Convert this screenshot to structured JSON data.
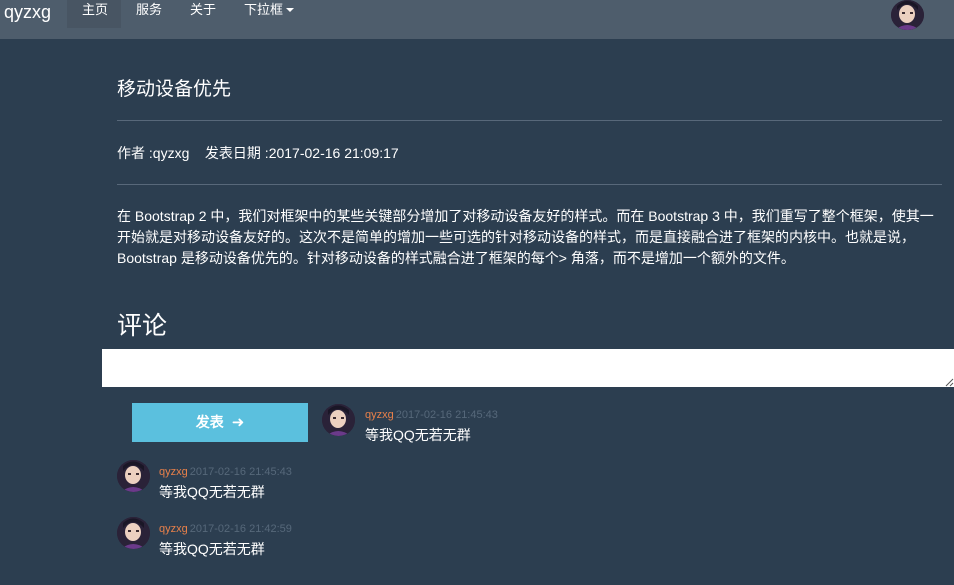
{
  "navbar": {
    "brand": "qyzxg",
    "items": [
      {
        "label": "主页",
        "active": true
      },
      {
        "label": "服务",
        "active": false
      },
      {
        "label": "关于",
        "active": false
      },
      {
        "label": "下拉框",
        "active": false,
        "dropdown": true
      }
    ],
    "avatar_icon": "user-avatar"
  },
  "article": {
    "title": "移动设备优先",
    "meta": "作者 :qyzxg    发表日期 :2017-02-16 21:09:17",
    "body": "在 Bootstrap 2 中，我们对框架中的某些关键部分增加了对移动设备友好的样式。而在 Bootstrap 3 中，我们重写了整个框架，使其一开始就是对移动设备友好的。这次不是简单的增加一些可选的针对移动设备的样式，而是直接融合进了框架的内核中。也就是说，Bootstrap 是移动设备优先的。针对移动设备的样式融合进了框架的每个> 角落，而不是增加一个额外的文件。"
  },
  "comments_section": {
    "heading": "评论",
    "input_value": "",
    "submit_label": "发表",
    "submit_icon": "arrow-right",
    "comments": [
      {
        "user": "qyzxg",
        "time": "2017-02-16 21:45:43",
        "text": "等我QQ无若无群"
      },
      {
        "user": "qyzxg",
        "time": "2017-02-16 21:45:43",
        "text": "等我QQ无若无群"
      },
      {
        "user": "qyzxg",
        "time": "2017-02-16 21:42:59",
        "text": "等我QQ无若无群"
      }
    ]
  },
  "colors": {
    "background": "#2c3e50",
    "navbar": "#4e5d6c",
    "button": "#5bc0de",
    "username": "#e8804a",
    "timestamp": "#56687a"
  }
}
